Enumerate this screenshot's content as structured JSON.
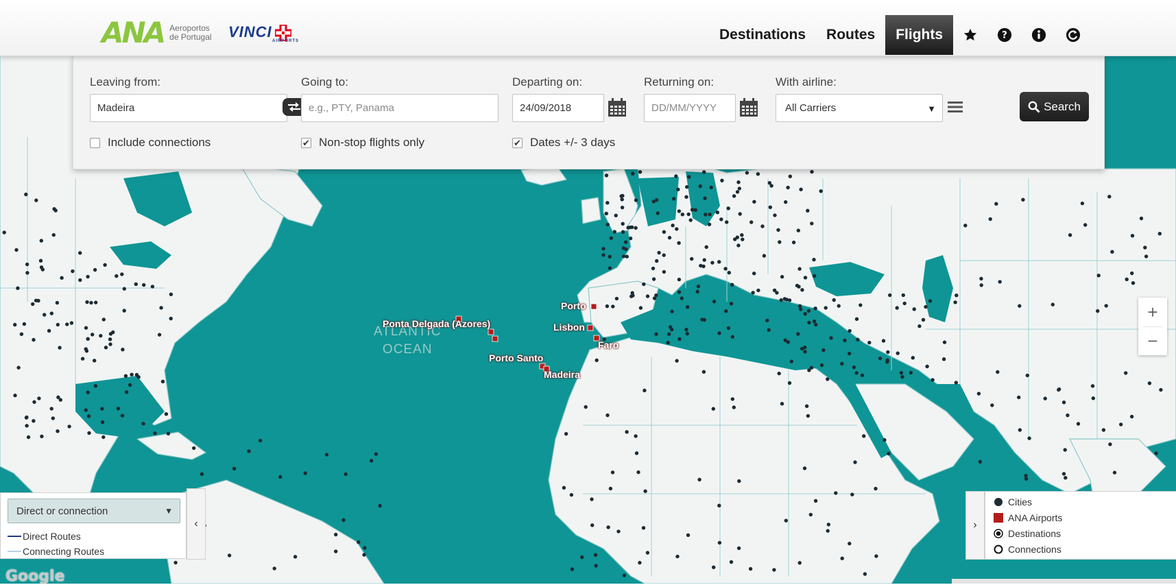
{
  "header": {
    "ana_logo_mark": "ANA",
    "ana_logo_text": "Aeroportos de Portugal",
    "vinci_logo_text": "VINCI",
    "vinci_logo_sub": "AIRPORTS",
    "nav": [
      {
        "label": "Destinations",
        "active": false
      },
      {
        "label": "Routes",
        "active": false
      },
      {
        "label": "Flights",
        "active": true
      }
    ],
    "icons": [
      "star-icon",
      "help-icon",
      "info-icon",
      "refresh-icon"
    ]
  },
  "search": {
    "leaving_from_label": "Leaving from:",
    "leaving_from_value": "Madeira",
    "going_to_label": "Going to:",
    "going_to_placeholder": "e.g., PTY, Panama",
    "departing_label": "Departing on:",
    "departing_value": "24/09/2018",
    "returning_label": "Returning on:",
    "returning_placeholder": "DD/MM/YYYY",
    "airline_label": "With airline:",
    "airline_value": "All Carriers",
    "include_connections_label": "Include connections",
    "include_connections_checked": false,
    "nonstop_label": "Non-stop flights only",
    "nonstop_checked": true,
    "dates_flex_label": "Dates +/- 3 days",
    "dates_flex_checked": true,
    "search_button_label": "Search"
  },
  "map": {
    "ocean_label_line1": "ATLANTIC",
    "ocean_label_line2": "OCEAN",
    "airports": [
      "Porto",
      "Lisbon",
      "Faro",
      "Ponta Delgada (Azores)",
      "Porto Santo",
      "Madeira"
    ],
    "zoom_in": "+",
    "zoom_out": "−",
    "google_logo": "Google",
    "colors": {
      "ocean": "#0f9595",
      "land": "#f2f4f4",
      "border": "#8cc8c8",
      "city": "#1d2b33",
      "airport": "#b41c1c"
    }
  },
  "route_panel": {
    "selected_option": "Direct or connection",
    "direct_routes_label": "Direct Routes",
    "connecting_routes_label": "Connecting Routes",
    "toggle_glyph": "‹"
  },
  "legend": {
    "items": [
      "Cities",
      "ANA Airports",
      "Destinations",
      "Connections"
    ],
    "toggle_glyph": "›"
  }
}
